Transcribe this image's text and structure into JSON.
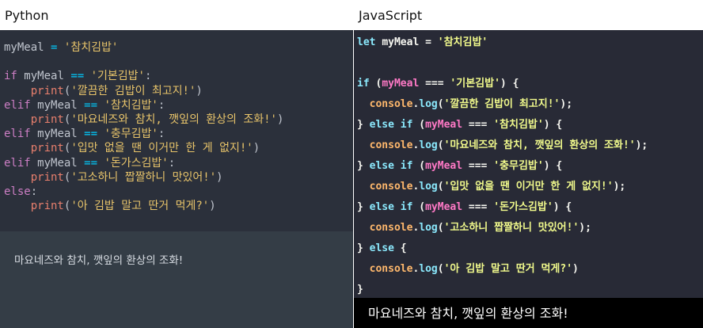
{
  "python": {
    "title": "Python",
    "output": "마요네즈와 참치, 깻잎의 환상의 조화!",
    "code": {
      "var": "myMeal",
      "assign_op": "=",
      "eq_op": "==",
      "kw_if": "if",
      "kw_elif": "elif",
      "kw_else": "else",
      "fn_print": "print",
      "init_value": "'참치김밥'",
      "case1_value": "'기본김밥'",
      "case1_msg": "'깔끔한 김밥이 최고지!'",
      "case2_value": "'참치김밥'",
      "case2_msg": "'마요네즈와 참치, 깻잎의 환상의 조화!'",
      "case3_value": "'충무김밥'",
      "case3_msg": "'입맛 없을 땐 이거만 한 게 없지!'",
      "case4_value": "'돈가스김밥'",
      "case4_msg": "'고소하니 짭짤하니 맛있어!'",
      "else_msg": "'아 김밥 말고 딴거 먹게?'"
    }
  },
  "javascript": {
    "title": "JavaScript",
    "output": "마요네즈와 참치, 깻잎의 환상의 조화!",
    "code": {
      "kw_let": "let",
      "kw_if": "if",
      "kw_else": "else",
      "var": "myMeal",
      "assign_op": "=",
      "eq_op": "===",
      "console": "console",
      "log": "log",
      "init_value": "'참치김밥'",
      "case1_value": "'기본김밥'",
      "case1_msg": "'깔끔한 김밥이 최고지!'",
      "case2_value": "'참치김밥'",
      "case2_msg": "'마요네즈와 참치, 깻잎의 환상의 조화!'",
      "case3_value": "'충무김밥'",
      "case3_msg": "'입맛 없을 땐 이거만 한 게 없지!'",
      "case4_value": "'돈가스김밥'",
      "case4_msg": "'고소하니 짭짤하니 맛있어!'",
      "else_msg": "'아 김밥 말고 딴거 먹게?'"
    }
  },
  "colors": {
    "python_bg": "#2b303b",
    "python_output_bg": "#343d46",
    "js_bg": "#282a36",
    "js_output_bg": "#000000"
  }
}
